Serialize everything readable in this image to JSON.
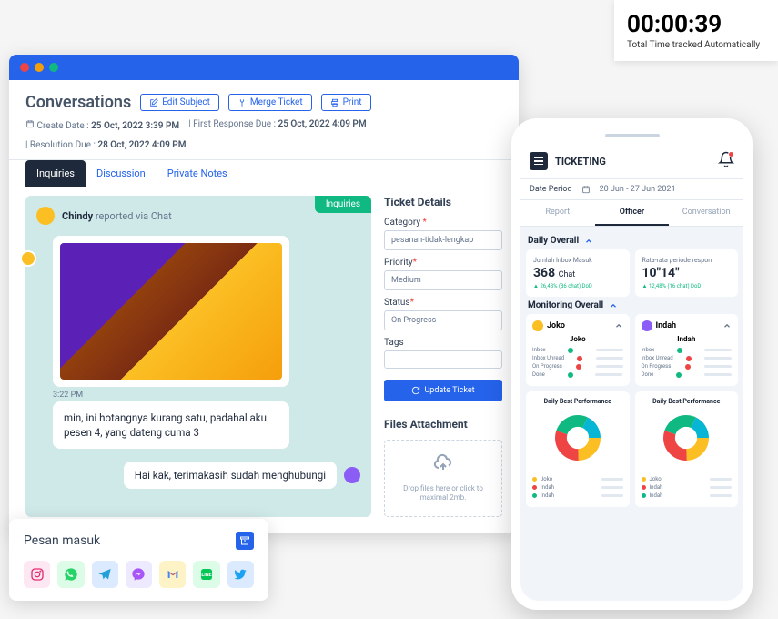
{
  "timer": {
    "value": "00:00:39",
    "label": "Total Time tracked Automatically"
  },
  "conversations": {
    "title": "Conversations",
    "buttons": {
      "edit": "Edit Subject",
      "merge": "Merge Ticket",
      "print": "Print"
    },
    "meta": {
      "create_label": "Create Date :",
      "create_value": "25 Oct, 2022 3:39 PM",
      "first_label": "First Response Due :",
      "first_value": "25 Oct, 2022 4:09 PM",
      "res_label": "Resolution Due :",
      "res_value": "28 Oct, 2022 4:09 PM"
    },
    "tabs": {
      "inquiries": "Inquiries",
      "discussion": "Discussion",
      "private": "Private Notes"
    },
    "chat": {
      "badge": "Inquiries",
      "sender_name": "Chindy",
      "sender_via": "reported via Chat",
      "timestamp": "3:22 PM",
      "msg_in": "min, ini hotangnya kurang satu, padahal aku pesen 4, yang dateng cuma 3",
      "msg_out": "Hai kak, terimakasih sudah menghubungi"
    },
    "details": {
      "title": "Ticket Details",
      "category_label": "Category",
      "category_value": "pesanan-tidak-lengkap",
      "priority_label": "Priority",
      "priority_value": "Medium",
      "status_label": "Status",
      "status_value": "On Progress",
      "tags_label": "Tags",
      "update_btn": "Update Ticket"
    },
    "attach": {
      "title": "Files Attachment",
      "drop": "Drop files here or click to maximal 2mb."
    }
  },
  "inbox": {
    "title": "Pesan masuk"
  },
  "mobile": {
    "title": "TICKETING",
    "date_label": "Date Period",
    "date_value": "20 Jun - 27 Jun 2021",
    "tabs": {
      "report": "Report",
      "officer": "Officer",
      "conversation": "Conversation"
    },
    "daily_overall": "Daily Overall",
    "stats": [
      {
        "label": "Jumlah Inbox Masuk",
        "value": "368",
        "unit": "Chat",
        "delta": "26,48% (86 chat) DoD"
      },
      {
        "label": "Rata-rata periode respon",
        "value": "10\"14\"",
        "unit": "",
        "delta": "12,48% (16 chat) DoD"
      }
    ],
    "monitoring_overall": "Monitoring Overall",
    "officers": [
      {
        "name": "Joko",
        "sub": "Joko"
      },
      {
        "name": "Indah",
        "sub": "Indah"
      }
    ],
    "mon_rows": [
      "Inbox",
      "Inbox Unread",
      "On Progress",
      "Done"
    ],
    "perf_title": "Daily Best Performance",
    "legend": [
      "Joko",
      "Indah",
      "Indah"
    ],
    "colors": {
      "yellow": "#fbbf24",
      "red": "#ef4444",
      "green": "#10b981",
      "teal": "#06b6d4"
    }
  }
}
